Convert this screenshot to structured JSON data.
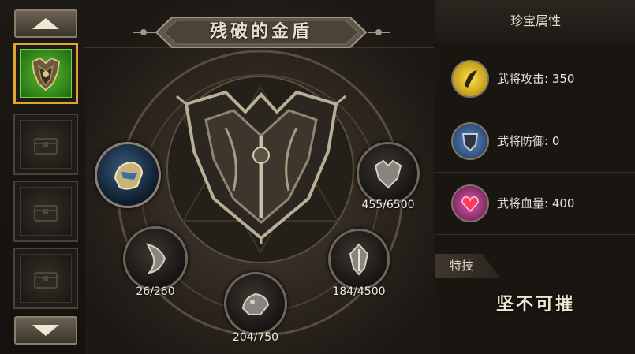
{
  "item": {
    "name": "残破的金盾"
  },
  "sidebar": {
    "scroll_up": "up-arrow-icon",
    "scroll_down": "down-arrow-icon",
    "slots": [
      {
        "state": "selected",
        "icon": "golden-shield-icon"
      },
      {
        "state": "locked",
        "icon": "chest-icon"
      },
      {
        "state": "locked",
        "icon": "chest-icon"
      },
      {
        "state": "locked",
        "icon": "chest-icon"
      }
    ]
  },
  "fragments": [
    {
      "icon": "helmet-fragment-icon",
      "progress": "",
      "state": "active"
    },
    {
      "icon": "shield-fragment-icon",
      "progress": "455/6500"
    },
    {
      "icon": "shield-fragment-icon",
      "progress": "26/260"
    },
    {
      "icon": "shield-fragment-icon",
      "progress": "184/4500"
    },
    {
      "icon": "shield-fragment-icon",
      "progress": "204/750"
    }
  ],
  "panel": {
    "title": "珍宝属性",
    "stats": [
      {
        "icon": "attack-orb-icon",
        "label": "武将攻击: 350",
        "color": "#e8c21a"
      },
      {
        "icon": "defense-shield-icon",
        "label": "武将防御: 0",
        "color": "#3c6fa8"
      },
      {
        "icon": "health-heart-icon",
        "label": "武将血量: 400",
        "color": "#c0398c"
      }
    ],
    "skill_header": "特技",
    "skill_name": "坚不可摧"
  }
}
